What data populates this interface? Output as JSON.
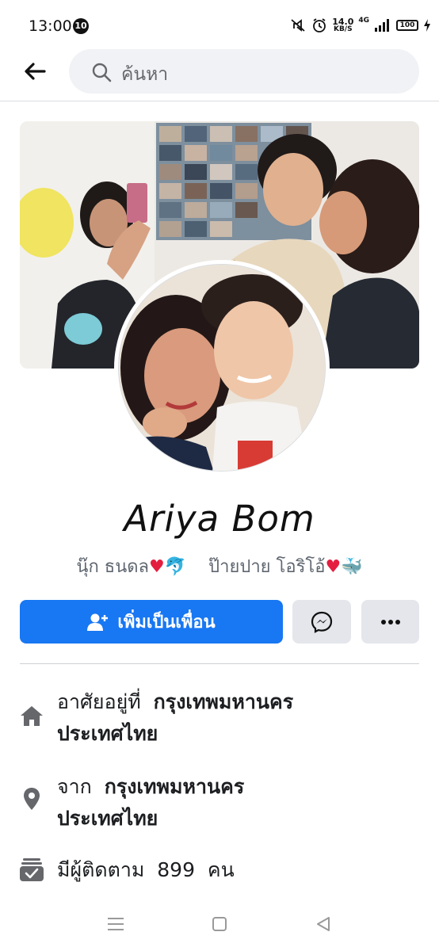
{
  "status_bar": {
    "time": "13:00",
    "notification_count": "10",
    "net_speed_value": "14.0",
    "net_speed_unit": "KB/S",
    "network_type": "4G",
    "battery": "100"
  },
  "search": {
    "placeholder": "ค้นหา"
  },
  "profile": {
    "name": "Ariya Bom",
    "bio_part1": "นุ๊ก  ธนดล",
    "bio_part1_emoji": "🐬",
    "bio_part2": "ป๊ายปาย  โอริโอ้",
    "bio_part2_emoji": "🐳",
    "heart": "♥"
  },
  "actions": {
    "add_friend_label": "เพิ่มเป็นเพื่อน"
  },
  "details": {
    "lives_prefix": "อาศัยอยู่ที่",
    "lives_city": "กรุงเทพมหานคร",
    "lives_country": "ประเทศไทย",
    "from_prefix": "จาก",
    "from_city": "กรุงเทพมหานคร",
    "from_country": "ประเทศไทย",
    "followers_prefix": "มีผู้ติดตาม",
    "followers_count": "899",
    "followers_suffix": "คน"
  },
  "colors": {
    "accent": "#1877f2",
    "secondary_button": "#e4e6eb",
    "search_bg": "#f0f2f5",
    "icon_gray": "#65676b"
  }
}
